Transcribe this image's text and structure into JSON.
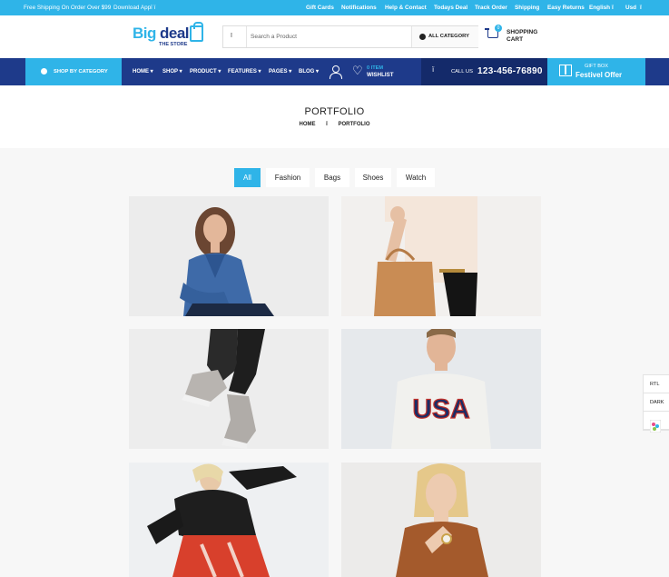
{
  "topbar": {
    "shipping": "Free Shipping On Order Over $99",
    "download": "Download App",
    "download_icons": "",
    "links": [
      "Gift Cards",
      "Notifications",
      "Help & Contact",
      "Todays Deal",
      "Track Order",
      "Shipping",
      "Easy Returns"
    ],
    "language": "English",
    "currency": "Usd"
  },
  "header": {
    "logo_part1": "Big",
    "logo_part2": "deal",
    "logo_tagline": "THE STORE",
    "search_placeholder": "Search a Product",
    "search_icon": "search-icon",
    "category_label": "ALL CATEGORY",
    "cart_count": "0",
    "cart_line1": "SHOPPING",
    "cart_line2": "CART"
  },
  "nav": {
    "shop_by_category": "SHOP BY CATEGORY",
    "menu": [
      "HOME",
      "SHOP",
      "PRODUCT",
      "FEATURES",
      "PAGES",
      "BLOG"
    ],
    "wishlist_count": "0 ITEM",
    "wishlist_label": "WISHLIST",
    "call_label": "CALL US",
    "phone": "123-456-76890",
    "gift_line1": "GIFT BOX",
    "gift_line2": "Festivel Offer"
  },
  "page": {
    "title": "PORTFOLIO",
    "breadcrumb": [
      "HOME",
      "PORTFOLIO"
    ]
  },
  "filters": [
    "All",
    "Fashion",
    "Bags",
    "Shoes",
    "Watch"
  ],
  "active_filter": "All",
  "portfolio_items": [
    {
      "name": "woman-denim-shirt",
      "bg": "#ececec"
    },
    {
      "name": "woman-tan-handbag",
      "bg": "#f2f0ee"
    },
    {
      "name": "sneakers-jeans",
      "bg": "#ededed"
    },
    {
      "name": "man-usa-sweater",
      "bg": "#e6e9ec"
    },
    {
      "name": "woman-jumping-jacket",
      "bg": "#eef0f2"
    },
    {
      "name": "woman-brown-jacket-watch",
      "bg": "#ecebea"
    }
  ],
  "side_panel": {
    "rtl": "RTL",
    "dark": "DARK"
  },
  "colors": {
    "accent": "#2fb4e8",
    "navy": "#1e3a8a"
  }
}
